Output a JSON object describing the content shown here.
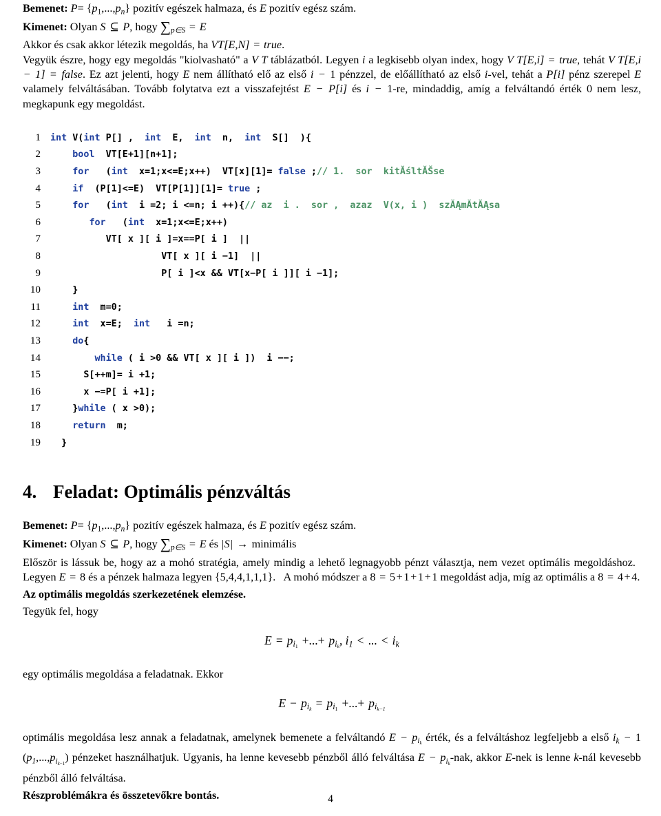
{
  "document": {
    "page_number": "4",
    "language": "hu"
  },
  "intro": {
    "input_label": "Bemenet:",
    "input_text_1": "P",
    "input_text_2": "= {",
    "input_p1": "p",
    "input_p1_sub": "1",
    "input_dots": ",...,",
    "input_pn": "p",
    "input_pn_sub": "n",
    "input_close": "} pozitív egészek halmaza, és",
    "input_E": "E",
    "input_tail": "pozitív egész szám.",
    "output_label": "Kimenet:",
    "output_olyan": "Olyan",
    "output_S": "S",
    "output_subset": "⊆",
    "output_P": "P",
    "output_hogy": ", hogy",
    "output_sum": "∑",
    "output_sum_sub": "p∈S",
    "output_eq": "=",
    "output_E": "E",
    "line3": "Akkor és csak akkor létezik megoldás, ha",
    "line3_vt": "VT",
    "line3_args": "[E,N]",
    "line3_eq": "=",
    "line3_true": "true",
    "line3_end": ".",
    "body": "Vegyük észre, hogy egy megoldás \"kiolvasható\" a VT táblázatból. Legyen i a legkisebb olyan index, hogy VT[E,i] = true, tehát VT[E,i−1] = false. Ez azt jelenti, hogy E nem állítható elő az első i−1 pénzzel, de előállítható az első i-vel, tehát a P[i] pénz szerepel E valamely felváltásában. Tovább folytatva ezt a visszafejtést E − P[i] és i−1-re, mindaddig, amíg a felváltandó érték 0 nem lesz, megkapunk egy megoldást."
  },
  "code": {
    "language": "cpp",
    "colors": {
      "keyword": "#1f3f9e",
      "identifier": "#000000",
      "comment": "#4d9466",
      "line_number": "#000000"
    },
    "lines": [
      {
        "n": "1",
        "tokens": [
          {
            "t": "kw",
            "s": "int"
          },
          {
            "t": "id",
            "s": " V("
          },
          {
            "t": "kw",
            "s": "int"
          },
          {
            "t": "id",
            "s": " P[] ,  "
          },
          {
            "t": "kw",
            "s": "int"
          },
          {
            "t": "id",
            "s": "  E,  "
          },
          {
            "t": "kw",
            "s": "int"
          },
          {
            "t": "id",
            "s": "  n,  "
          },
          {
            "t": "kw",
            "s": "int"
          },
          {
            "t": "id",
            "s": "  S[]  ){"
          }
        ]
      },
      {
        "n": "2",
        "tokens": [
          {
            "t": "id",
            "s": "    "
          },
          {
            "t": "kw",
            "s": "bool"
          },
          {
            "t": "id",
            "s": "  VT[E+1][n+1];"
          }
        ]
      },
      {
        "n": "3",
        "tokens": [
          {
            "t": "id",
            "s": "    "
          },
          {
            "t": "kw",
            "s": "for"
          },
          {
            "t": "id",
            "s": "   ("
          },
          {
            "t": "kw",
            "s": "int"
          },
          {
            "t": "id",
            "s": "  x=1;x<=E;x++)  VT[x][1]= "
          },
          {
            "t": "kw",
            "s": "false"
          },
          {
            "t": "id",
            "s": " ;"
          },
          {
            "t": "cm",
            "s": "// 1.  sor  kitĂśltĂŠse"
          }
        ]
      },
      {
        "n": "4",
        "tokens": [
          {
            "t": "id",
            "s": "    "
          },
          {
            "t": "kw",
            "s": "if"
          },
          {
            "t": "id",
            "s": "  (P[1]<=E)  VT[P[1]][1]= "
          },
          {
            "t": "kw",
            "s": "true"
          },
          {
            "t": "id",
            "s": " ;"
          }
        ]
      },
      {
        "n": "5",
        "tokens": [
          {
            "t": "id",
            "s": "    "
          },
          {
            "t": "kw",
            "s": "for"
          },
          {
            "t": "id",
            "s": "   ("
          },
          {
            "t": "kw",
            "s": "int"
          },
          {
            "t": "id",
            "s": "  i =2; i <=n; i ++){"
          },
          {
            "t": "cm",
            "s": "// az  i .  sor ,  azaz  V(x, i )  szĂĄmĂ­tĂĄsa"
          }
        ]
      },
      {
        "n": "6",
        "tokens": [
          {
            "t": "id",
            "s": "       "
          },
          {
            "t": "kw",
            "s": "for"
          },
          {
            "t": "id",
            "s": "   ("
          },
          {
            "t": "kw",
            "s": "int"
          },
          {
            "t": "id",
            "s": "  x=1;x<=E;x++)"
          }
        ]
      },
      {
        "n": "7",
        "tokens": [
          {
            "t": "id",
            "s": "          VT[ x ][ i ]=x==P[ i ]  ||"
          }
        ]
      },
      {
        "n": "8",
        "tokens": [
          {
            "t": "id",
            "s": "                    VT[ x ][ i −1]  ||"
          }
        ]
      },
      {
        "n": "9",
        "tokens": [
          {
            "t": "id",
            "s": "                    P[ i ]<x && VT[x−P[ i ]][ i −1];"
          }
        ]
      },
      {
        "n": "10",
        "tokens": [
          {
            "t": "id",
            "s": "    }"
          }
        ]
      },
      {
        "n": "11",
        "tokens": [
          {
            "t": "id",
            "s": "    "
          },
          {
            "t": "kw",
            "s": "int"
          },
          {
            "t": "id",
            "s": "  m=0;"
          }
        ]
      },
      {
        "n": "12",
        "tokens": [
          {
            "t": "id",
            "s": "    "
          },
          {
            "t": "kw",
            "s": "int"
          },
          {
            "t": "id",
            "s": "  x=E;  "
          },
          {
            "t": "kw",
            "s": "int"
          },
          {
            "t": "id",
            "s": "   i =n;"
          }
        ]
      },
      {
        "n": "13",
        "tokens": [
          {
            "t": "id",
            "s": "    "
          },
          {
            "t": "kw",
            "s": "do"
          },
          {
            "t": "id",
            "s": "{"
          }
        ]
      },
      {
        "n": "14",
        "tokens": [
          {
            "t": "id",
            "s": "        "
          },
          {
            "t": "kw",
            "s": "while"
          },
          {
            "t": "id",
            "s": " ( i >0 && VT[ x ][ i ])  i −−;"
          }
        ]
      },
      {
        "n": "15",
        "tokens": [
          {
            "t": "id",
            "s": "      S[++m]= i +1;"
          }
        ]
      },
      {
        "n": "16",
        "tokens": [
          {
            "t": "id",
            "s": "      x −=P[ i +1];"
          }
        ]
      },
      {
        "n": "17",
        "tokens": [
          {
            "t": "id",
            "s": "    }"
          },
          {
            "t": "kw",
            "s": "while"
          },
          {
            "t": "id",
            "s": " ( x >0);"
          }
        ]
      },
      {
        "n": "18",
        "tokens": [
          {
            "t": "id",
            "s": "    "
          },
          {
            "t": "kw",
            "s": "return"
          },
          {
            "t": "id",
            "s": "  m;"
          }
        ]
      },
      {
        "n": "19",
        "tokens": [
          {
            "t": "id",
            "s": "  }"
          }
        ]
      }
    ]
  },
  "section": {
    "number": "4.",
    "title": "Feladat: Optimális pénzváltás"
  },
  "problem": {
    "input_label": "Bemenet:",
    "input_P": "P",
    "input_eq": "= {",
    "input_p": "p",
    "input_p_sub": "1",
    "input_dots": ",...,",
    "input_pn": "p",
    "input_pn_sub": "n",
    "input_rest": "} pozitív egészek halmaza, és",
    "input_E": "E",
    "input_tail": "pozitív egész szám.",
    "output_label": "Kimenet:",
    "output_olyan": "Olyan",
    "output_S": "S",
    "output_subset": "⊆",
    "output_P": "P",
    "output_hogy": ", hogy",
    "output_sum": "∑",
    "output_sum_sub": "p∈S",
    "output_eq": "=",
    "output_E": "E",
    "output_es": "és",
    "output_absS": "|S|",
    "output_arrow": "→",
    "output_minimal": "minimális",
    "greedy_text": "Először is lássuk be, hogy az a mohó stratégia, amely mindig a lehető legnagyobb pénzt választja, nem vezet optimális megoldáshoz. Legyen E = 8 és a pénzek halmaza legyen {5,4,4,1,1,1}. A mohó módszer a 8 = 5+1+1+1 megoldást adja, míg az optimális a 8 = 4+4.",
    "structure_heading": "Az optimális megoldás szerkezetének elemzése.",
    "assume": "Tegyük fel, hogy",
    "eq1": {
      "E": "E",
      "eq": "=",
      "p1": "p",
      "p1_sub_i": "i",
      "p1_sub_1": "1",
      "plus_dots": "+...+",
      "pk": "p",
      "pk_sub_i": "i",
      "pk_sub_k": "k",
      "comma": ",",
      "i1": "i",
      "i1_sub": "1",
      "lt": "<",
      "dots": "...",
      "lt2": "<",
      "ik": "i",
      "ik_sub": "k"
    },
    "after_eq1": "egy optimális megoldása a feladatnak. Ekkor",
    "eq2": {
      "E": "E",
      "minus": "−",
      "pk": "p",
      "pk_sub_i": "i",
      "pk_sub_k": "k",
      "eq": "=",
      "p1": "p",
      "p1_sub_i": "i",
      "p1_sub_1": "1",
      "plus_dots": "+...+",
      "pl": "p",
      "pl_sub_i": "i",
      "pl_sub_km1": "k−1"
    },
    "final_text": "optimális megoldása lesz annak a feladatnak, amelynek bemenete a felváltandó E − p_{i_k} érték, és a felváltáshoz legfeljebb a első i_k − 1 (p_1,...,p_{i_k−1}) pénzeket használhatjuk. Ugyanis, ha lenne kevesebb pénzből álló felváltása E − p_{i_k}-nak, akkor E-nek is lenne k-nál kevesebb pénzből álló felváltása.",
    "decomposition_heading": "Részproblémákra és összetevőkre bontás."
  }
}
